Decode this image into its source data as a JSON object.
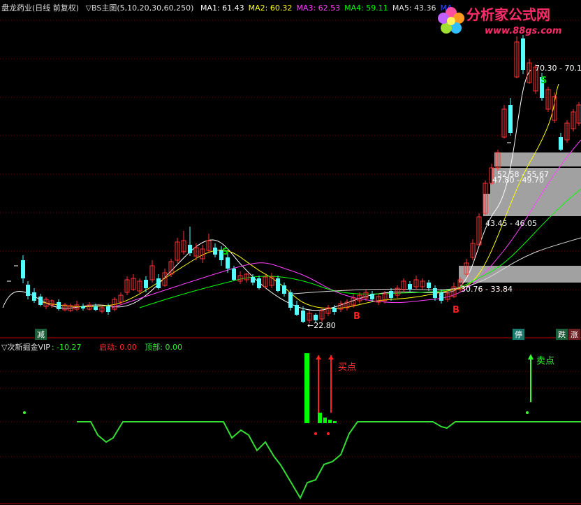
{
  "header": {
    "title": "盘龙药业(日线 前复权)",
    "indicator": "▽BS主图(5,10,20,30,60,250)",
    "ma": [
      {
        "label": "MA1: 61.43",
        "color": "#ffffff"
      },
      {
        "label": "MA2: 60.32",
        "color": "#ffff00"
      },
      {
        "label": "MA3: 62.53",
        "color": "#ff40ff"
      },
      {
        "label": "MA4: 59.11",
        "color": "#00ff00"
      },
      {
        "label": "MA5: 43.36",
        "color": "#dddddd"
      },
      {
        "label": "MA",
        "color": "#3050ff"
      }
    ]
  },
  "logo": {
    "text": "分析家公式网",
    "url": "www.88gs.com"
  },
  "sub_header": {
    "name": "▽次新掘金VIP",
    "value": ": -10.27",
    "start_label": "启动: 0.00",
    "top_label": "顶部: 0.00"
  },
  "tags": {
    "jian": "减",
    "ting": "停",
    "die": "跌",
    "zhang": "涨"
  },
  "colors": {
    "up": "#ff3232",
    "down": "#54ffff",
    "osc": "#33dd33",
    "bar": "#00ff00",
    "signal": "#ff2020",
    "grid": "#800000"
  },
  "chart_data": {
    "type": "candlestick",
    "price_labels": [
      {
        "text": "70.30 - 70.1"
      },
      {
        "text": "52.58 - 55.67"
      },
      {
        "text": "47.80 - 49.70"
      },
      {
        "text": "43.45 - 46.05"
      },
      {
        "text": "30.76 - 33.84"
      },
      {
        "text": "←22.80"
      }
    ],
    "signals": [
      {
        "text": "S",
        "color": "#00cc00"
      },
      {
        "text": "S",
        "color": "#00cc00"
      },
      {
        "text": "B",
        "color": "#ff2020"
      },
      {
        "text": "B",
        "color": "#ff2020"
      }
    ],
    "sub_signals": [
      {
        "text": "买点",
        "color": "#ff3030"
      },
      {
        "text": "卖点",
        "color": "#33ff33"
      }
    ]
  }
}
